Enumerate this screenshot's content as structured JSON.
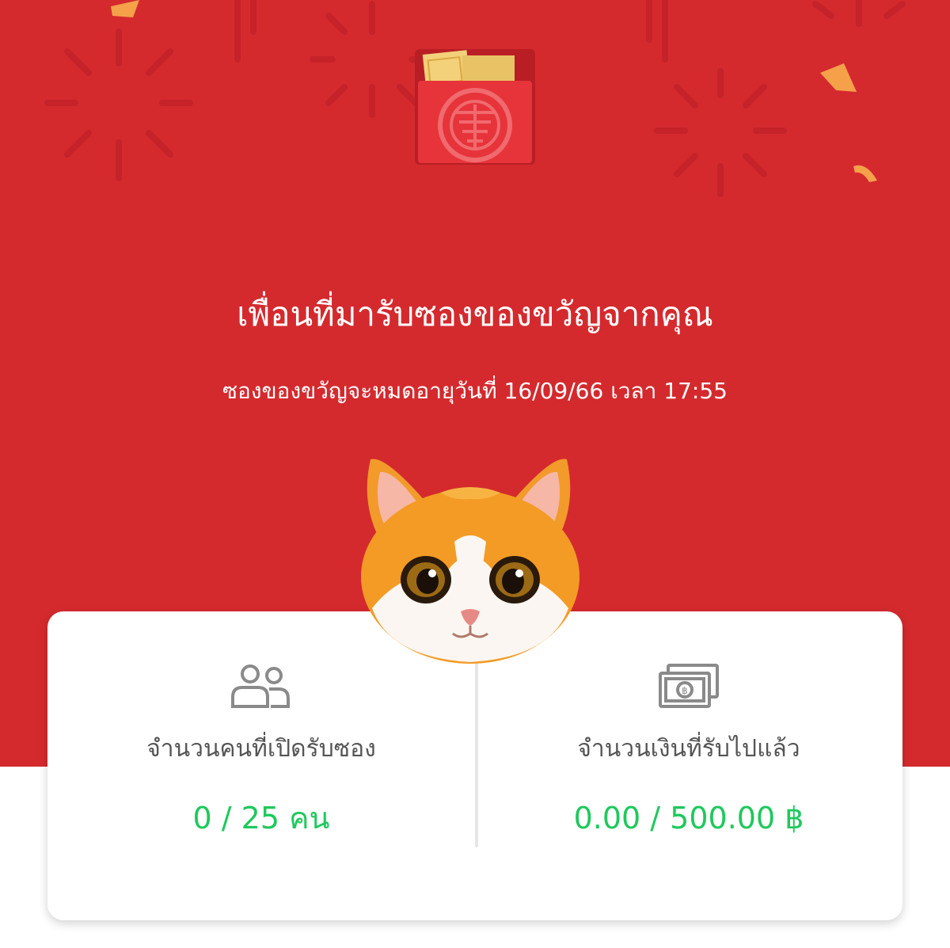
{
  "header": {
    "title": "เพื่อนที่มารับซองของขวัญจากคุณ",
    "expiry": "ซองของขวัญจะหมดอายุวันที่ 16/09/66 เวลา 17:55"
  },
  "stats": {
    "receivers": {
      "icon": "people-icon",
      "label": "จำนวนคนที่เปิดรับซอง",
      "value": "0 / 25 คน"
    },
    "amount": {
      "icon": "banknote-icon",
      "label": "จำนวนเงินที่รับไปแล้ว",
      "value": "0.00 / 500.00 ฿"
    }
  },
  "colors": {
    "background_red": "#d42a2e",
    "value_green": "#1ec95c",
    "label_gray": "#555555"
  }
}
